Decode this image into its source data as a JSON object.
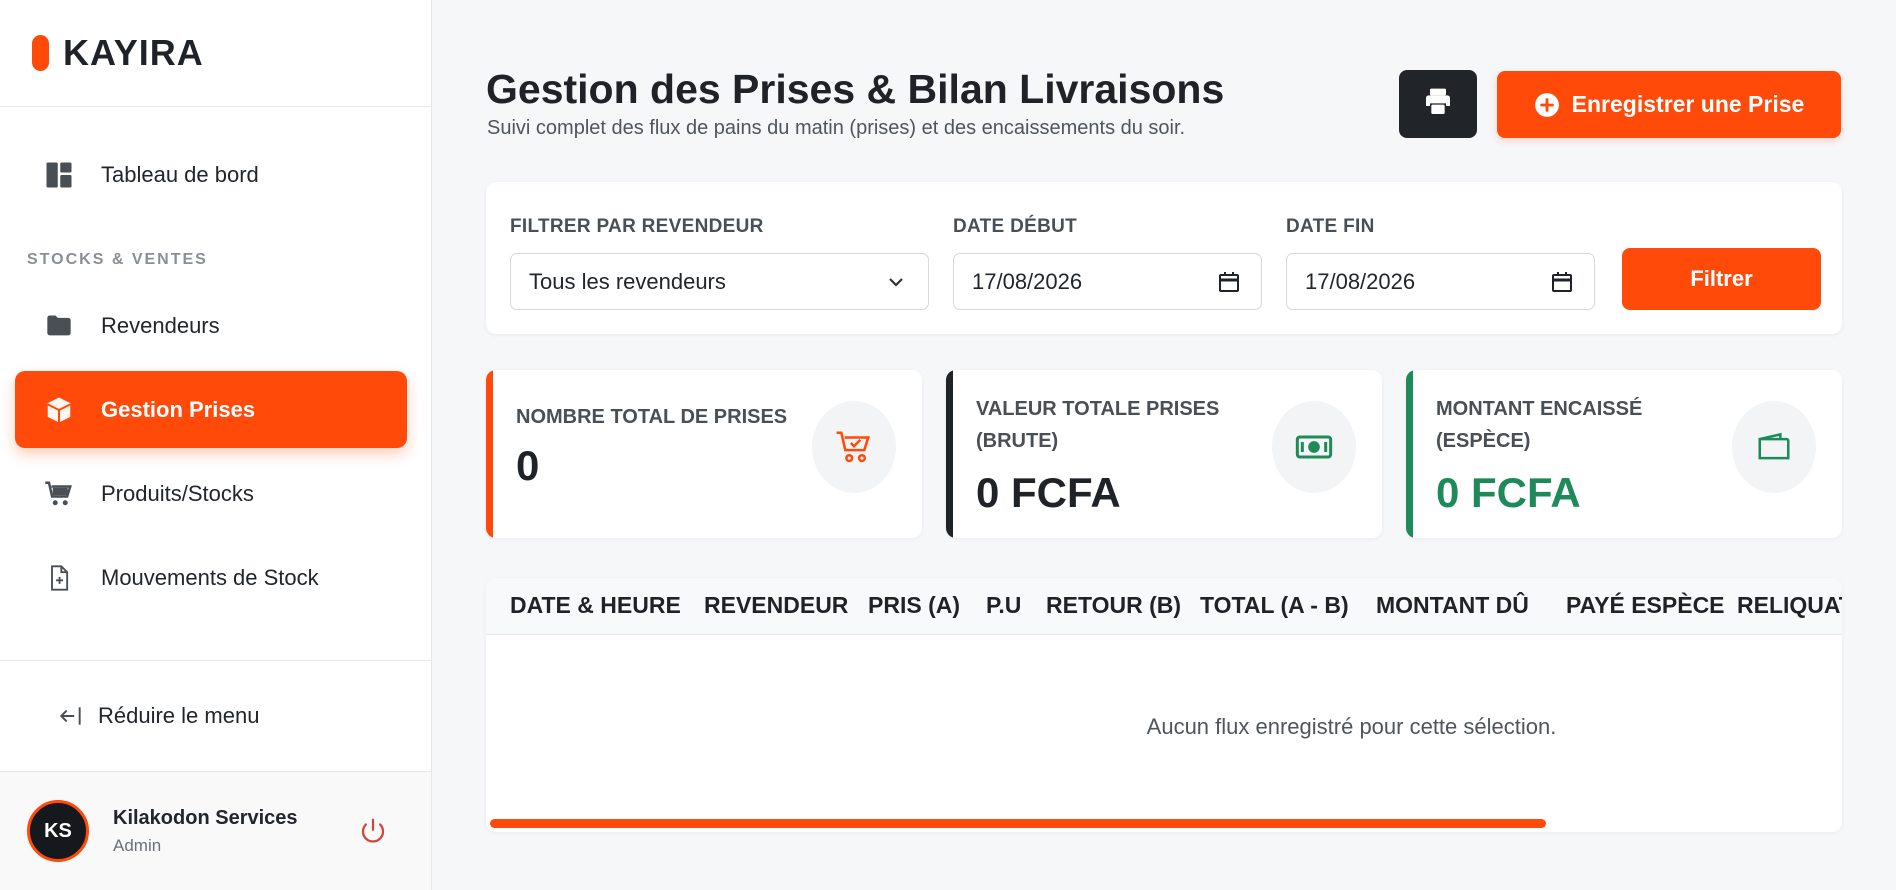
{
  "brand": {
    "name": "KAYIRA"
  },
  "sidebar": {
    "items": [
      {
        "label": "Tableau de bord"
      },
      {
        "label": "Revendeurs"
      },
      {
        "label": "Gestion Prises"
      },
      {
        "label": "Produits/Stocks"
      },
      {
        "label": "Mouvements de Stock"
      }
    ],
    "section_label": "STOCKS & VENTES",
    "collapse_label": "Réduire le menu"
  },
  "user": {
    "initials": "KS",
    "name": "Kilakodon Services",
    "role": "Admin"
  },
  "header": {
    "title": "Gestion des Prises & Bilan Livraisons",
    "subtitle": "Suivi complet des flux de pains du matin (prises) et des encaissements du soir.",
    "add_label": "Enregistrer une Prise"
  },
  "filters": {
    "reseller_label": "FILTRER PAR REVENDEUR",
    "reseller_value": "Tous les revendeurs",
    "start_label": "DATE DÉBUT",
    "start_value": "17/08/2026",
    "end_label": "DATE FIN",
    "end_value": "17/08/2026",
    "submit_label": "Filtrer"
  },
  "stats": [
    {
      "label": "NOMBRE TOTAL DE PRISES",
      "value": "0",
      "accent": "#ff4a0a"
    },
    {
      "label": "VALEUR TOTALE PRISES (BRUTE)",
      "value": "0 FCFA",
      "accent": "#1f2328"
    },
    {
      "label": "MONTANT ENCAISSÉ (ESPÈCE)",
      "value": "0 FCFA",
      "accent": "#1e8a5a"
    }
  ],
  "table": {
    "columns": [
      "DATE & HEURE",
      "REVENDEUR",
      "PRIS (A)",
      "P.U",
      "RETOUR (B)",
      "TOTAL (A - B)",
      "MONTANT DÛ",
      "PAYÉ ESPÈCE",
      "RELIQUAT"
    ],
    "empty_message": "Aucun flux enregistré pour cette sélection."
  },
  "colors": {
    "accent": "#ff4a0a",
    "dark": "#212529",
    "success": "#1e8a5a"
  }
}
